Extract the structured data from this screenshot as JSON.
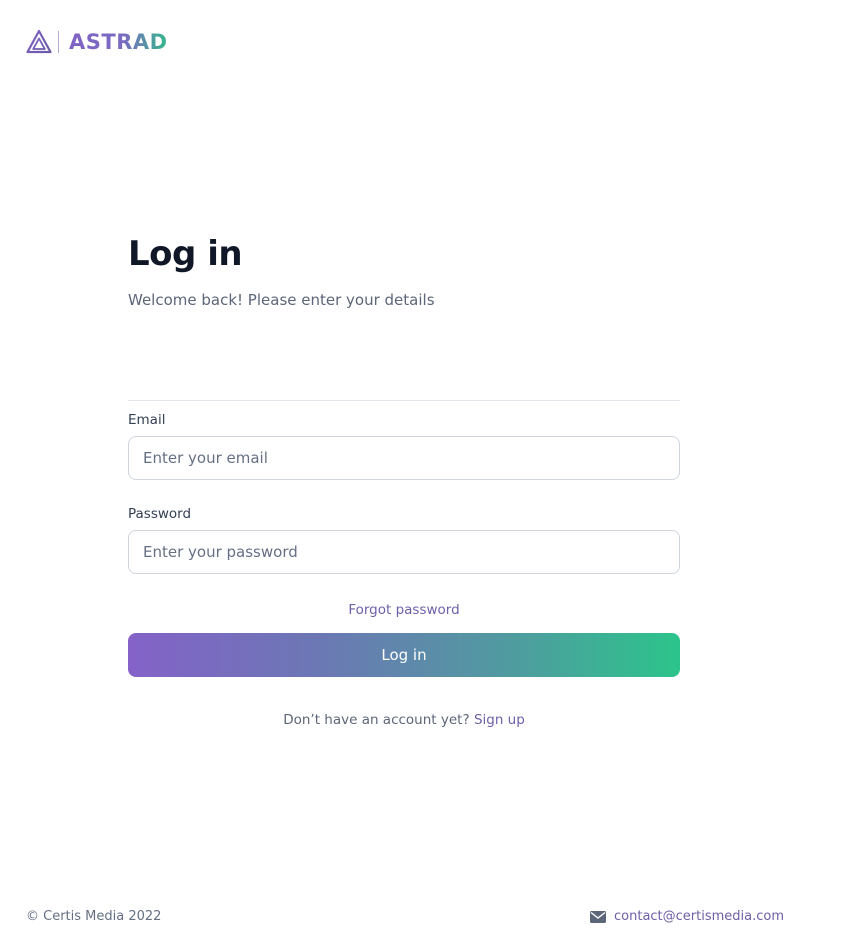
{
  "brand": {
    "name": "ASTRAD",
    "logo_icon": "triangle-logo-icon",
    "colors": {
      "purple": "#8062c4",
      "green": "#34b98b"
    }
  },
  "login": {
    "title": "Log in",
    "subtitle": "Welcome back! Please enter your details",
    "email": {
      "label": "Email",
      "placeholder": "Enter your email",
      "value": ""
    },
    "password": {
      "label": "Password",
      "placeholder": "Enter your password",
      "value": ""
    },
    "forgot_password": "Forgot password",
    "submit_label": "Log in",
    "signup_prompt": "Don’t have an account yet?",
    "signup_link": "Sign up"
  },
  "footer": {
    "copyright": "© Certis Media 2022",
    "contact_icon": "mail-icon",
    "contact_email": "contact@certismedia.com"
  }
}
